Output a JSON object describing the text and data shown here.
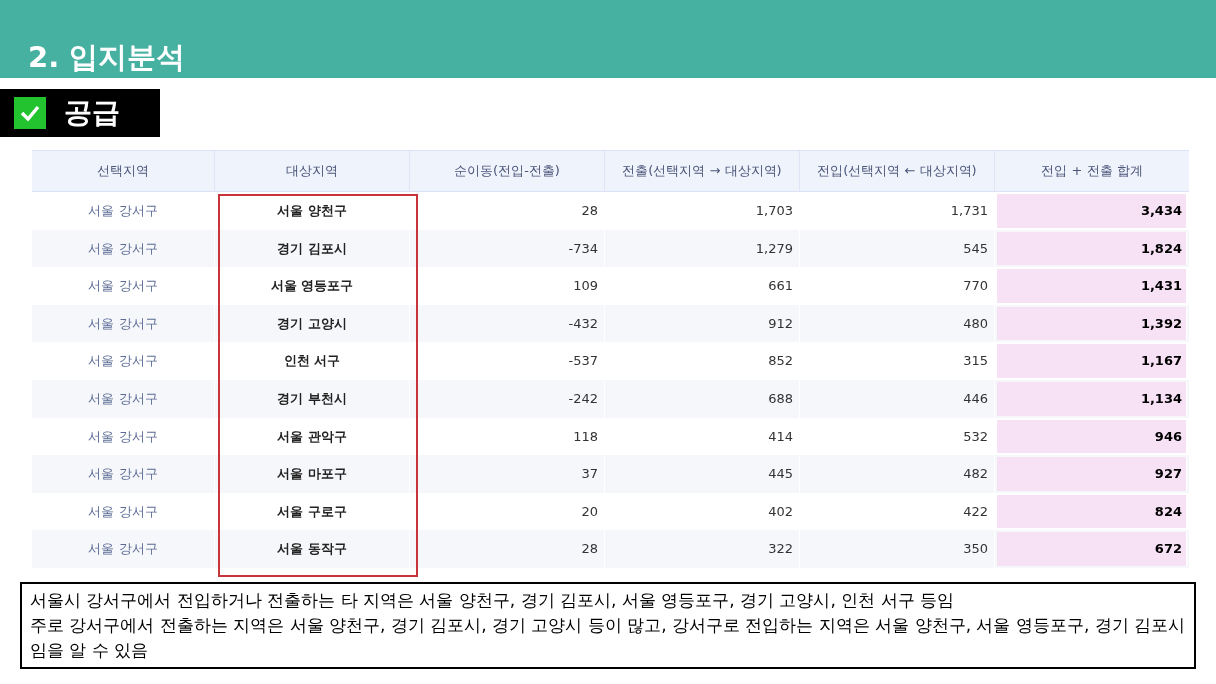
{
  "header": {
    "title": "2. 입지분석"
  },
  "section": {
    "label": "공급",
    "checked": true
  },
  "table": {
    "columns": [
      {
        "label": "선택지역",
        "framed": false
      },
      {
        "label": "대상지역",
        "framed": true
      },
      {
        "label": "순이동(전입-전출)",
        "framed": false
      },
      {
        "label": "전출(선택지역 → 대상지역)",
        "framed": false
      },
      {
        "label": "전입(선택지역 ← 대상지역)",
        "framed": false
      },
      {
        "label": "전입 + 전출 합계",
        "framed": false
      }
    ],
    "rows": [
      [
        "서울 강서구",
        "서울 양천구",
        "28",
        "1,703",
        "1,731",
        "3,434"
      ],
      [
        "서울 강서구",
        "경기 김포시",
        "-734",
        "1,279",
        "545",
        "1,824"
      ],
      [
        "서울 강서구",
        "서울 영등포구",
        "109",
        "661",
        "770",
        "1,431"
      ],
      [
        "서울 강서구",
        "경기 고양시",
        "-432",
        "912",
        "480",
        "1,392"
      ],
      [
        "서울 강서구",
        "인천 서구",
        "-537",
        "852",
        "315",
        "1,167"
      ],
      [
        "서울 강서구",
        "경기 부천시",
        "-242",
        "688",
        "446",
        "1,134"
      ],
      [
        "서울 강서구",
        "서울 관악구",
        "118",
        "414",
        "532",
        "946"
      ],
      [
        "서울 강서구",
        "서울 마포구",
        "37",
        "445",
        "482",
        "927"
      ],
      [
        "서울 강서구",
        "서울 구로구",
        "20",
        "402",
        "422",
        "824"
      ],
      [
        "서울 강서구",
        "서울 동작구",
        "28",
        "322",
        "350",
        "672"
      ]
    ]
  },
  "note": [
    "서울시 강서구에서 전입하거나 전출하는 타 지역은 서울 양천구, 경기 김포시, 서울 영등포구, 경기 고양시, 인천 서구 등임",
    "주로 강서구에서 전출하는 지역은 서울 양천구, 경기 김포시, 경기 고양시 등이 많고, 강서구로 전입하는 지역은 서울 양천구, 서울 영등포구, 경기 김포시임을 알 수 있음"
  ]
}
